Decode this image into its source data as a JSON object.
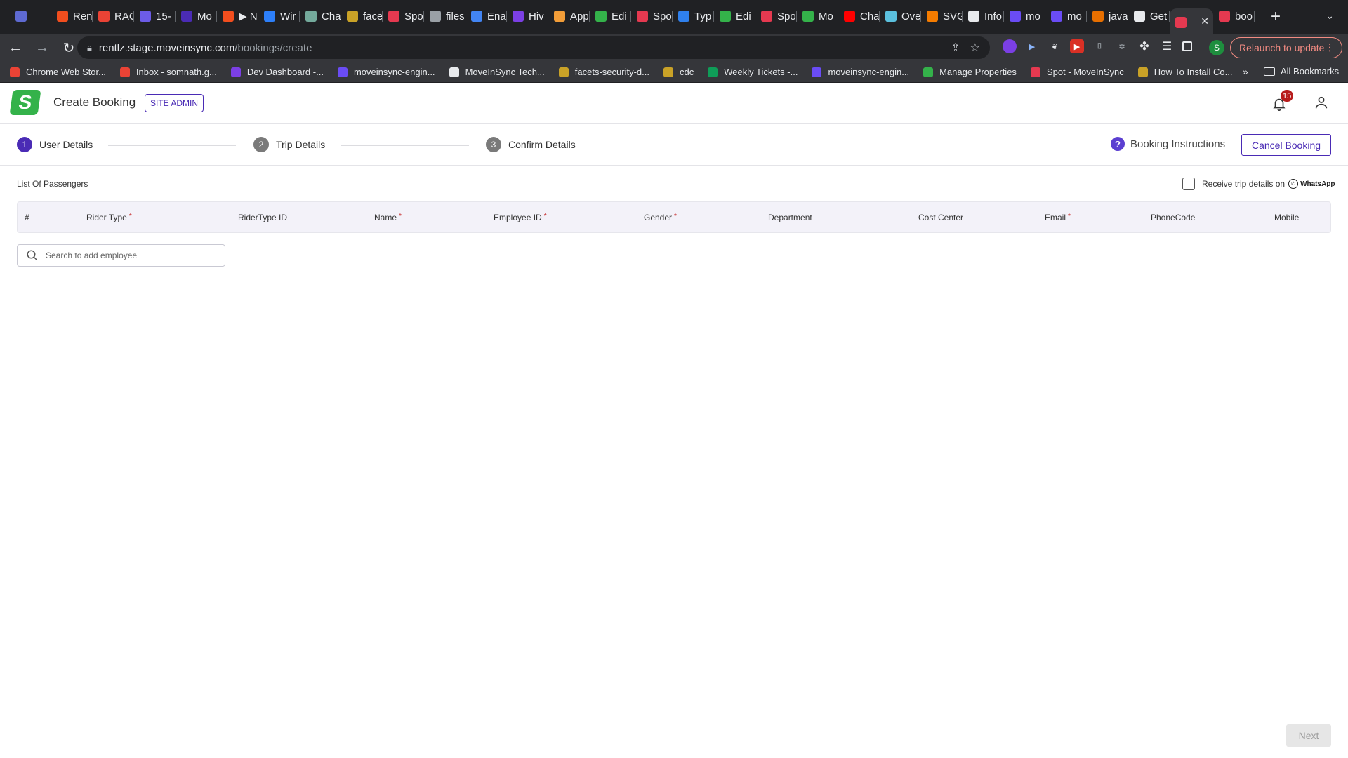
{
  "browser": {
    "tabs": [
      {
        "title": "",
        "icon": "linear-icon",
        "color": "#5e6ad2"
      },
      {
        "title": "Ren",
        "icon": "figma-icon",
        "color": "#f24e1e"
      },
      {
        "title": "RAC",
        "icon": "gmail-icon",
        "color": "#ea4335"
      },
      {
        "title": "15-",
        "icon": "docs-icon",
        "color": "#6c5ce7"
      },
      {
        "title": "Mo",
        "icon": "calendar-icon",
        "color": "#4a2bb5"
      },
      {
        "title": "▶ N",
        "icon": "figma-icon",
        "color": "#f24e1e"
      },
      {
        "title": "Wir",
        "icon": "wireframe-icon",
        "color": "#2d7ff9"
      },
      {
        "title": "Cha",
        "icon": "chatgpt-icon",
        "color": "#74aa9c"
      },
      {
        "title": "face",
        "icon": "wolf-icon",
        "color": "#c9a227"
      },
      {
        "title": "Spo",
        "icon": "moveinsync-icon",
        "color": "#e53950"
      },
      {
        "title": "files",
        "icon": "globe-icon",
        "color": "#9aa0a6"
      },
      {
        "title": "Ena",
        "icon": "chrome-icon",
        "color": "#4285f4"
      },
      {
        "title": "Hiv",
        "icon": "hive-icon",
        "color": "#7b3fe4"
      },
      {
        "title": "App",
        "icon": "app-icon",
        "color": "#f29d38"
      },
      {
        "title": "Edi",
        "icon": "moveinsync-green-icon",
        "color": "#34b24a"
      },
      {
        "title": "Spo",
        "icon": "moveinsync-icon",
        "color": "#e53950"
      },
      {
        "title": "Typ",
        "icon": "vscode-icon",
        "color": "#2f80ed"
      },
      {
        "title": "Edi",
        "icon": "moveinsync-green-icon",
        "color": "#34b24a"
      },
      {
        "title": "Spo",
        "icon": "moveinsync-icon",
        "color": "#e53950"
      },
      {
        "title": "Mo",
        "icon": "moveinsync-green-icon",
        "color": "#34b24a"
      },
      {
        "title": "Cha",
        "icon": "youtube-icon",
        "color": "#ff0000"
      },
      {
        "title": "Ove",
        "icon": "pen-icon",
        "color": "#5bc0de"
      },
      {
        "title": "SVG",
        "icon": "svg-icon",
        "color": "#f57c00"
      },
      {
        "title": "Info",
        "icon": "google-icon",
        "color": "#e8eaed"
      },
      {
        "title": "mo",
        "icon": "moveinsync-purple-icon",
        "color": "#6a4cf5"
      },
      {
        "title": "mo",
        "icon": "moveinsync-purple-icon",
        "color": "#6a4cf5"
      },
      {
        "title": "java",
        "icon": "java-icon",
        "color": "#e76f00"
      },
      {
        "title": "Get",
        "icon": "google-icon",
        "color": "#e8eaed"
      },
      {
        "title": "",
        "icon": "moveinsync-icon",
        "color": "#e53950",
        "active": true
      },
      {
        "title": "boo",
        "icon": "refresh-icon",
        "color": "#e53950"
      }
    ],
    "url_host": "rentlz.stage.moveinsync.com",
    "url_path": "/bookings/create",
    "relaunch_label": "Relaunch to update",
    "profile_initial": "S",
    "bookmarks": [
      {
        "label": "Chrome Web Stor...",
        "color": "#ea4335"
      },
      {
        "label": "Inbox - somnath.g...",
        "color": "#ea4335"
      },
      {
        "label": "Dev Dashboard -...",
        "color": "#7b3fe4"
      },
      {
        "label": "moveinsync-engin...",
        "color": "#6a4cf5"
      },
      {
        "label": "MoveInSync Tech...",
        "color": "#e8eaed"
      },
      {
        "label": "facets-security-d...",
        "color": "#c9a227"
      },
      {
        "label": "cdc",
        "color": "#c9a227"
      },
      {
        "label": "Weekly Tickets -...",
        "color": "#0f9d58"
      },
      {
        "label": "moveinsync-engin...",
        "color": "#6a4cf5"
      },
      {
        "label": "Manage Properties",
        "color": "#34b24a"
      },
      {
        "label": "Spot - MoveInSync",
        "color": "#e53950"
      },
      {
        "label": "How To Install Co...",
        "color": "#c9a227"
      }
    ],
    "bookmarks_more": "»",
    "all_bookmarks": "All Bookmarks"
  },
  "app": {
    "title": "Create Booking",
    "role_badge": "SITE ADMIN",
    "notification_count": "15",
    "brand_color": "#4a2bb5",
    "logo_color": "#34b24a"
  },
  "stepper": {
    "steps": [
      {
        "num": "1",
        "label": "User Details",
        "active": true
      },
      {
        "num": "2",
        "label": "Trip Details",
        "active": false
      },
      {
        "num": "3",
        "label": "Confirm Details",
        "active": false
      }
    ],
    "instructions_label": "Booking Instructions",
    "cancel_label": "Cancel Booking"
  },
  "passengers": {
    "section_title": "List Of Passengers",
    "whatsapp_label": "Receive trip details on",
    "whatsapp_brand": "WhatsApp",
    "whatsapp_checked": false,
    "columns": [
      {
        "label": "#",
        "required": false
      },
      {
        "label": "Rider Type",
        "required": true
      },
      {
        "label": "RiderType ID",
        "required": false
      },
      {
        "label": "Name",
        "required": true
      },
      {
        "label": "Employee ID",
        "required": true
      },
      {
        "label": "Gender",
        "required": true
      },
      {
        "label": "Department",
        "required": false
      },
      {
        "label": "Cost Center",
        "required": false
      },
      {
        "label": "Email",
        "required": true
      },
      {
        "label": "PhoneCode",
        "required": false
      },
      {
        "label": "Mobile",
        "required": false
      }
    ],
    "required_mark": "*",
    "search_placeholder": "Search to add employee"
  },
  "footer": {
    "next_label": "Next",
    "next_disabled": true
  }
}
